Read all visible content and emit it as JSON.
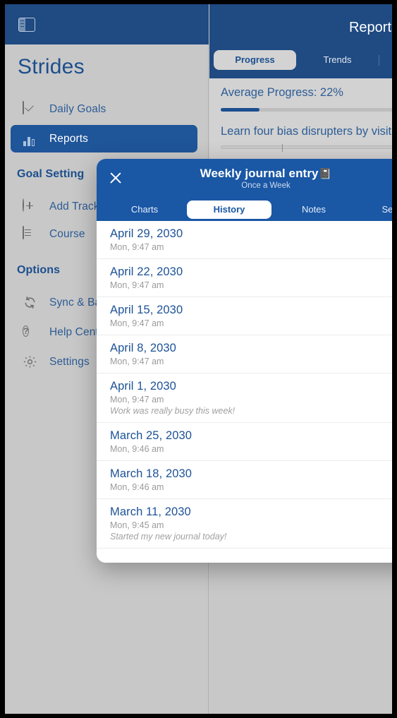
{
  "sidebar": {
    "toggle_icon": "sidebar-toggle-icon",
    "app_title": "Strides",
    "nav": [
      {
        "label": "Daily Goals",
        "icon": "checkbox-icon",
        "active": false
      },
      {
        "label": "Reports",
        "icon": "bar-chart-icon",
        "active": true
      }
    ],
    "section_goal_setting": "Goal Setting",
    "goal_items": [
      {
        "label": "Add Tracker",
        "icon": "plus-circle-icon"
      },
      {
        "label": "Course",
        "icon": "document-icon"
      }
    ],
    "section_options": "Options",
    "option_items": [
      {
        "label": "Sync & Backup",
        "icon": "sync-icon"
      },
      {
        "label": "Help Center",
        "icon": "question-circle-icon"
      },
      {
        "label": "Settings",
        "icon": "gear-icon"
      }
    ]
  },
  "right_pane": {
    "title": "Reports",
    "segments": [
      {
        "label": "Progress",
        "selected": true
      },
      {
        "label": "Trends",
        "selected": false
      }
    ],
    "average_progress_label": "Average Progress: 22%",
    "average_progress_percent": 22,
    "goal_title": "Learn four bias disrupters by visiting",
    "goal_progress_percent": 0
  },
  "modal": {
    "close_icon": "close-icon",
    "title": "Weekly journal entry",
    "title_emoji": "📓",
    "subtitle": "Once a Week",
    "tabs": [
      {
        "label": "Charts",
        "selected": false
      },
      {
        "label": "History",
        "selected": true
      },
      {
        "label": "Notes",
        "selected": false
      },
      {
        "label": "Settings",
        "selected": false
      }
    ],
    "history": [
      {
        "date": "April 29, 2030",
        "time": "Mon, 9:47 am",
        "note": ""
      },
      {
        "date": "April 22, 2030",
        "time": "Mon, 9:47 am",
        "note": ""
      },
      {
        "date": "April 15, 2030",
        "time": "Mon, 9:47 am",
        "note": ""
      },
      {
        "date": "April 8, 2030",
        "time": "Mon, 9:47 am",
        "note": ""
      },
      {
        "date": "April 1, 2030",
        "time": "Mon, 9:47 am",
        "note": "Work was really busy this week!"
      },
      {
        "date": "March 25, 2030",
        "time": "Mon, 9:46 am",
        "note": ""
      },
      {
        "date": "March 18, 2030",
        "time": "Mon, 9:46 am",
        "note": ""
      },
      {
        "date": "March 11, 2030",
        "time": "Mon, 9:45 am",
        "note": "Started my new journal today!"
      }
    ]
  },
  "colors": {
    "header_blue": "#1f4a82",
    "modal_blue": "#1a57a5",
    "accent_blue": "#1c5296",
    "sidebar_gray": "#c8c8c8",
    "active_nav": "#1f5599"
  }
}
